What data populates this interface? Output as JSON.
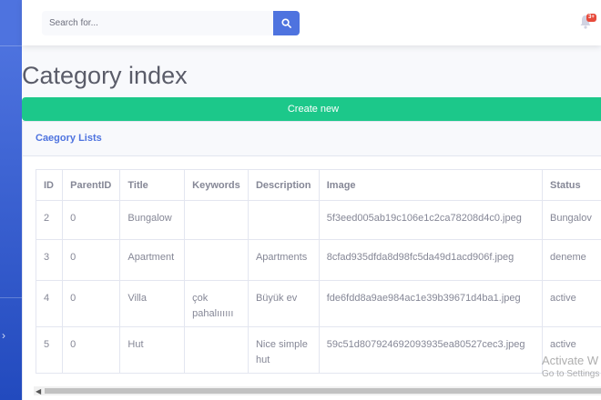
{
  "search": {
    "placeholder": "Search for..."
  },
  "notifications": {
    "badge": "3+"
  },
  "page": {
    "title": "Category index",
    "create_label": "Create new"
  },
  "card": {
    "title": "Caegory Lists"
  },
  "table": {
    "headers": [
      "ID",
      "ParentID",
      "Title",
      "Keywords",
      "Description",
      "Image",
      "Status"
    ],
    "rows": [
      [
        "2",
        "0",
        "Bungalow",
        "",
        "",
        "5f3eed005ab19c106e1c2ca78208d4c0.jpeg",
        "Bungalov"
      ],
      [
        "3",
        "0",
        "Apartment",
        "",
        "Apartments",
        "8cfad935dfda8d98fc5da49d1acd906f.jpeg",
        "deneme"
      ],
      [
        "4",
        "0",
        "Villa",
        "çok pahalıııııı",
        "Büyük ev",
        "fde6fdd8a9ae984ac1e39b39671d4ba1.jpeg",
        "active"
      ],
      [
        "5",
        "0",
        "Hut",
        "",
        "Nice simple hut",
        "59c51d807924692093935ea80527cec3.jpeg",
        "active"
      ]
    ]
  },
  "watermark": {
    "line1": "Activate W",
    "line2": "Go to Settings"
  },
  "icons": {
    "search": "search-icon",
    "bell": "bell-icon",
    "sidebar_toggle": "chevron-right-icon"
  },
  "colors": {
    "primary": "#4e73df",
    "success": "#1cc88a",
    "danger": "#e74a3b"
  }
}
